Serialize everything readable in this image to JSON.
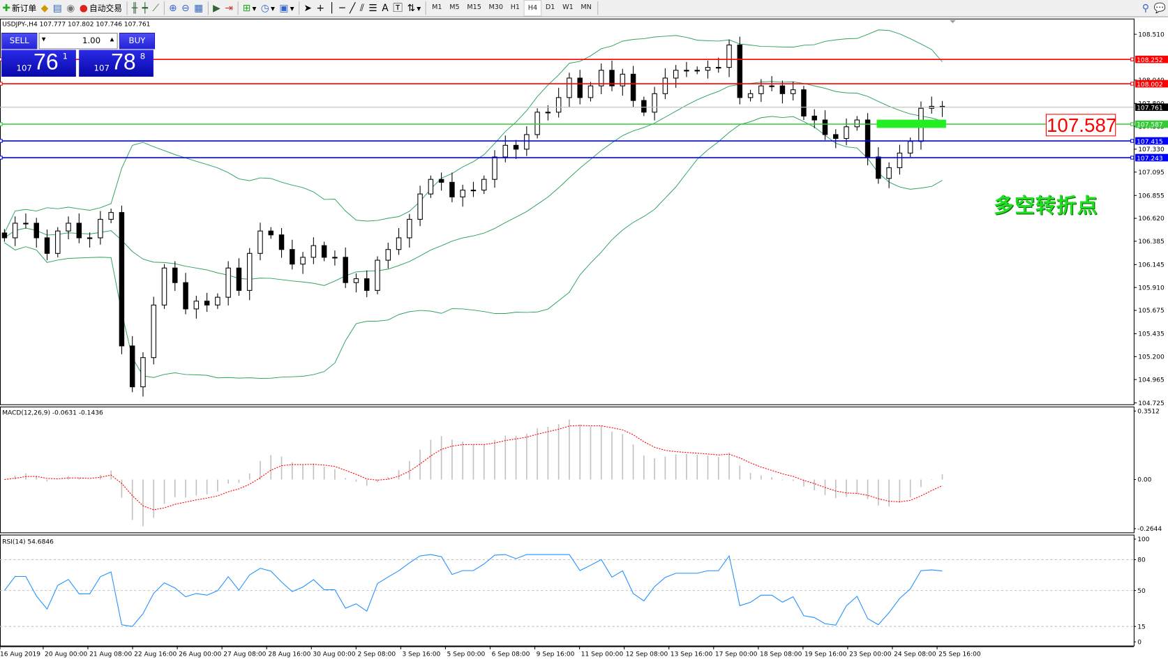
{
  "toolbar": {
    "new_order": "新订单",
    "auto_trading": "自动交易",
    "timeframes": [
      "M1",
      "M5",
      "M15",
      "M30",
      "H1",
      "H4",
      "D1",
      "W1",
      "MN"
    ],
    "active_timeframe": "H4"
  },
  "chart": {
    "symbol_info": "USDJPY-,H4  107.777 107.802 107.746 107.761",
    "trade_panel": {
      "sell_label": "SELL",
      "buy_label": "BUY",
      "lot": "1.00",
      "bid": {
        "big": "107",
        "main": "76",
        "small": "1"
      },
      "ask": {
        "big": "107",
        "main": "78",
        "small": "8"
      }
    },
    "price_ticks": [
      "108.510",
      "108.040",
      "107.800",
      "107.565",
      "107.330",
      "107.095",
      "106.855",
      "106.620",
      "106.385",
      "106.145",
      "105.910",
      "105.675",
      "105.435",
      "105.200",
      "104.965",
      "104.725"
    ],
    "levels": [
      {
        "price": "108.252",
        "color": "#ff0000"
      },
      {
        "price": "108.002",
        "color": "#ff0000"
      },
      {
        "price": "107.587",
        "color": "#33cc33"
      },
      {
        "price": "107.415",
        "color": "#0000ff"
      },
      {
        "price": "107.243",
        "color": "#0000ff"
      }
    ],
    "current_price": "107.761",
    "annotation_price": "107.587",
    "annotation_text": "多空转折点",
    "closes": [
      106.42,
      106.57,
      106.57,
      106.42,
      106.26,
      106.49,
      106.57,
      106.42,
      106.42,
      106.61,
      106.68,
      105.31,
      104.89,
      105.19,
      105.73,
      106.11,
      105.96,
      105.69,
      105.77,
      105.73,
      105.81,
      106.11,
      105.88,
      106.26,
      106.49,
      106.45,
      106.3,
      106.15,
      106.22,
      106.34,
      106.22,
      106.22,
      105.96,
      106.0,
      105.88,
      106.19,
      106.3,
      106.42,
      106.61,
      106.87,
      107.02,
      106.99,
      106.84,
      106.91,
      106.91,
      107.02,
      107.25,
      107.37,
      107.33,
      107.48,
      107.71,
      107.71,
      107.86,
      108.06,
      107.86,
      107.98,
      108.14,
      107.98,
      108.1,
      107.83,
      107.71,
      107.9,
      108.06,
      108.14,
      108.14,
      108.14,
      108.17,
      108.17,
      108.4,
      107.86,
      107.9,
      107.98,
      107.98,
      107.9,
      107.94,
      107.67,
      107.63,
      107.48,
      107.44,
      107.56,
      107.63,
      107.25,
      107.03,
      107.14,
      107.29,
      107.41,
      107.75,
      107.77,
      107.761
    ],
    "time_labels": [
      "16 Aug 2019",
      "20 Aug 00:00",
      "21 Aug 08:00",
      "22 Aug 16:00",
      "26 Aug 00:00",
      "27 Aug 08:00",
      "28 Aug 16:00",
      "30 Aug 00:00",
      "2 Sep 08:00",
      "3 Sep 16:00",
      "5 Sep 00:00",
      "6 Sep 08:00",
      "9 Sep 16:00",
      "11 Sep 00:00",
      "12 Sep 08:00",
      "13 Sep 16:00",
      "17 Sep 00:00",
      "18 Sep 08:00",
      "19 Sep 16:00",
      "23 Sep 00:00",
      "24 Sep 08:00",
      "25 Sep 16:00"
    ]
  },
  "macd": {
    "label": "MACD(12,26,9) -0.0631 -0.1436",
    "ticks": [
      "0.3512",
      "0.00",
      "-0.2644"
    ],
    "max": 0.3512,
    "min": -0.2644,
    "signal_color": "#ff0000",
    "hist_color": "#c0c0c0"
  },
  "rsi": {
    "label": "RSI(14) 54.6846",
    "ticks": [
      "100",
      "80",
      "50",
      "15",
      "0"
    ],
    "levels": [
      80,
      50,
      15
    ],
    "color": "#1e90ff"
  },
  "colors": {
    "bands": "#2ca25f",
    "grid": "#c0c0c0"
  }
}
